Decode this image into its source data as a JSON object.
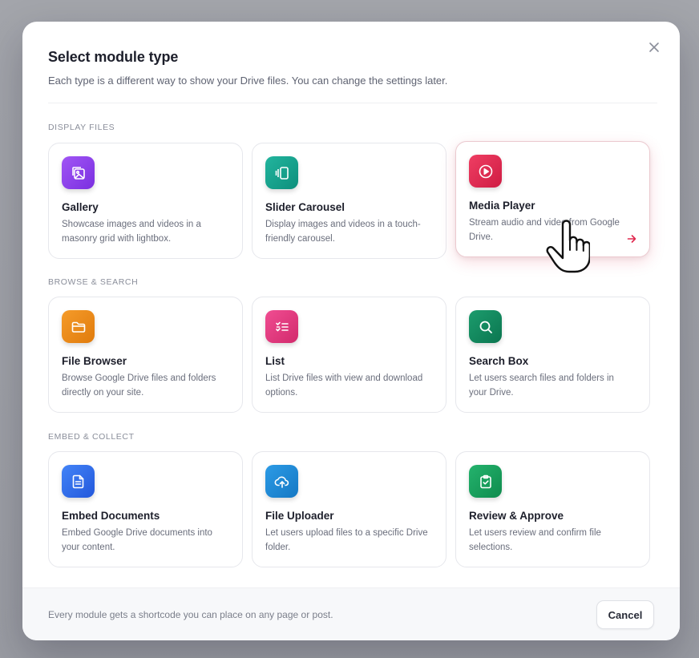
{
  "dialog": {
    "title": "Select module type",
    "subtitle": "Each type is a different way to show your Drive files. You can change the settings later.",
    "close_icon": "close-icon"
  },
  "sections": [
    {
      "label": "DISPLAY FILES",
      "cards": [
        {
          "title": "Gallery",
          "description": "Showcase images and videos in a masonry grid with lightbox.",
          "icon": "gallery-icon",
          "color": "#8b3ee6"
        },
        {
          "title": "Slider Carousel",
          "description": "Display images and videos in a touch-friendly carousel.",
          "icon": "carousel-icon",
          "color": "#13a18d"
        },
        {
          "title": "Media Player",
          "description": "Stream audio and video from Google Drive.",
          "icon": "play-icon",
          "color": "#e0284e"
        }
      ]
    },
    {
      "label": "BROWSE & SEARCH",
      "cards": [
        {
          "title": "File Browser",
          "description": "Browse Google Drive files and folders directly on your site.",
          "icon": "folder-icon",
          "color": "#ec8a16"
        },
        {
          "title": "List",
          "description": "List Drive files with view and download options.",
          "icon": "checklist-icon",
          "color": "#e33a7e"
        },
        {
          "title": "Search Box",
          "description": "Let users search files and folders in your Drive.",
          "icon": "search-icon",
          "color": "#0f8a5c"
        }
      ]
    },
    {
      "label": "EMBED & COLLECT",
      "cards": [
        {
          "title": "Embed Documents",
          "description": "Embed Google Drive documents into your content.",
          "icon": "document-icon",
          "color": "#2f6ef0"
        },
        {
          "title": "File Uploader",
          "description": "Let users upload files to a specific Drive folder.",
          "icon": "cloud-upload-icon",
          "color": "#1f8ad8"
        },
        {
          "title": "Review & Approve",
          "description": "Let users review and confirm file selections.",
          "icon": "clipboard-check-icon",
          "color": "#16a360"
        }
      ]
    }
  ],
  "footer": {
    "note": "Every module gets a shortcode you can place on any page or post.",
    "cancel_label": "Cancel"
  },
  "accent_color": "#e0284e"
}
